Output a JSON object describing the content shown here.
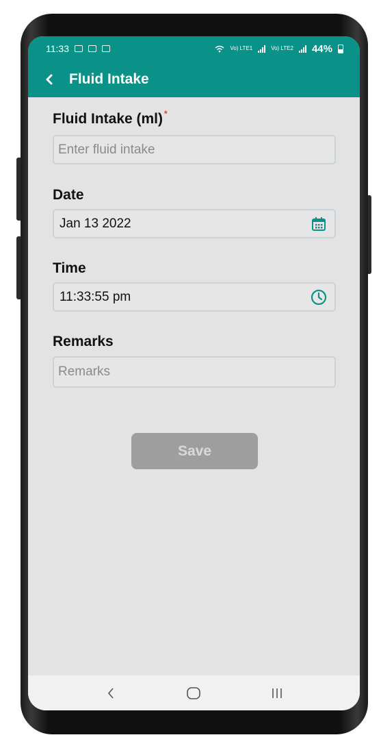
{
  "status_bar": {
    "time": "11:33",
    "network_1": "Vo) LTE1",
    "network_2": "Vo) LTE2",
    "battery": "44%"
  },
  "app_bar": {
    "title": "Fluid Intake",
    "back_icon": "chevron-left-icon"
  },
  "form": {
    "fluid_intake": {
      "label": "Fluid Intake (ml)",
      "required_mark": "*",
      "placeholder": "Enter fluid intake",
      "value": ""
    },
    "date": {
      "label": "Date",
      "value": "Jan 13 2022",
      "icon": "calendar-icon"
    },
    "time": {
      "label": "Time",
      "value": "11:33:55 pm",
      "icon": "clock-icon"
    },
    "remarks": {
      "label": "Remarks",
      "placeholder": "Remarks",
      "value": ""
    },
    "save_label": "Save"
  },
  "colors": {
    "primary": "#0a9188",
    "background": "#e3e3e3",
    "button_disabled": "#9e9e9e",
    "required": "#e53935"
  },
  "nav_bar": {
    "back_icon": "back-chevron-icon",
    "home_icon": "home-icon",
    "recents_icon": "recents-icon"
  }
}
